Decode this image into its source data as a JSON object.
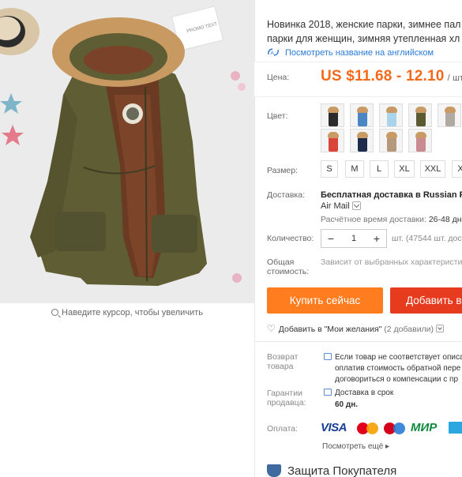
{
  "product": {
    "title_line1": "Новинка 2018, женские парки, зимнее пал",
    "title_line2": "парки для женщин, зимняя утепленная хл",
    "translate_link": "Посмотреть название на английском"
  },
  "gallery": {
    "zoom_hint": "Наведите курсор, чтобы увеличить",
    "card_text": "PROMO TEXT"
  },
  "price": {
    "label": "Цена:",
    "value": "US $11.68 - 12.10",
    "unit": "/ шт."
  },
  "color": {
    "label": "Цвет:",
    "swatches": [
      {
        "name": "black",
        "color": "#2b2b2b"
      },
      {
        "name": "blue",
        "color": "#4a86c4"
      },
      {
        "name": "light-blue",
        "color": "#a9d4ea"
      },
      {
        "name": "army-green",
        "color": "#5b5a33"
      },
      {
        "name": "grey",
        "color": "#b0aaa2"
      },
      {
        "name": "red",
        "color": "#d9453a"
      },
      {
        "name": "navy",
        "color": "#1e2b4a"
      },
      {
        "name": "khaki",
        "color": "#b6987a"
      },
      {
        "name": "pink",
        "color": "#c98a90"
      }
    ]
  },
  "size": {
    "label": "Размер:",
    "options": [
      "S",
      "M",
      "L",
      "XL",
      "XXL",
      "X"
    ]
  },
  "shipping": {
    "label": "Доставка:",
    "method_prefix": "Бесплатная доставка в ",
    "method_dest": "Russian Fede",
    "method_line2": "Air Mail",
    "eta_label": "Расчётное время доставки: ",
    "eta_days": "26-48 дн"
  },
  "quantity": {
    "label": "Количество:",
    "minus": "−",
    "value": "1",
    "plus": "+",
    "stock": "шт. (47544 шт. дост"
  },
  "total": {
    "label_line1": "Общая",
    "label_line2": "стоимость:",
    "note": "Зависит от выбранных характеристик"
  },
  "actions": {
    "buy_now": "Купить сейчас",
    "add_to_cart": "Добавить в"
  },
  "wishlist": {
    "label": "Добавить в \"Мои желания\"",
    "count": "(2 добавили)"
  },
  "returns": {
    "label_line1": "Возврат",
    "label_line2": "товара",
    "text_line1": "Если товар не соответствует описа",
    "text_line2": "оплатив стоимость обратной пере",
    "text_line3": "договориться о компенсации с пр"
  },
  "guarantee": {
    "label_line1": "Гарантии",
    "label_line2": "продавца:",
    "text_line1": "Доставка в срок",
    "text_line2": "60 дн."
  },
  "payment": {
    "label": "Оплата:",
    "visa": "VISA",
    "mir": "МИР",
    "more": "Посмотреть ещё"
  },
  "protection": {
    "title": "Защита Покупателя"
  },
  "colors": {
    "price_orange": "#f56a1a",
    "buy_button": "#ff7c1f",
    "cart_button": "#e63b1f",
    "link_blue": "#2a7ad6"
  }
}
